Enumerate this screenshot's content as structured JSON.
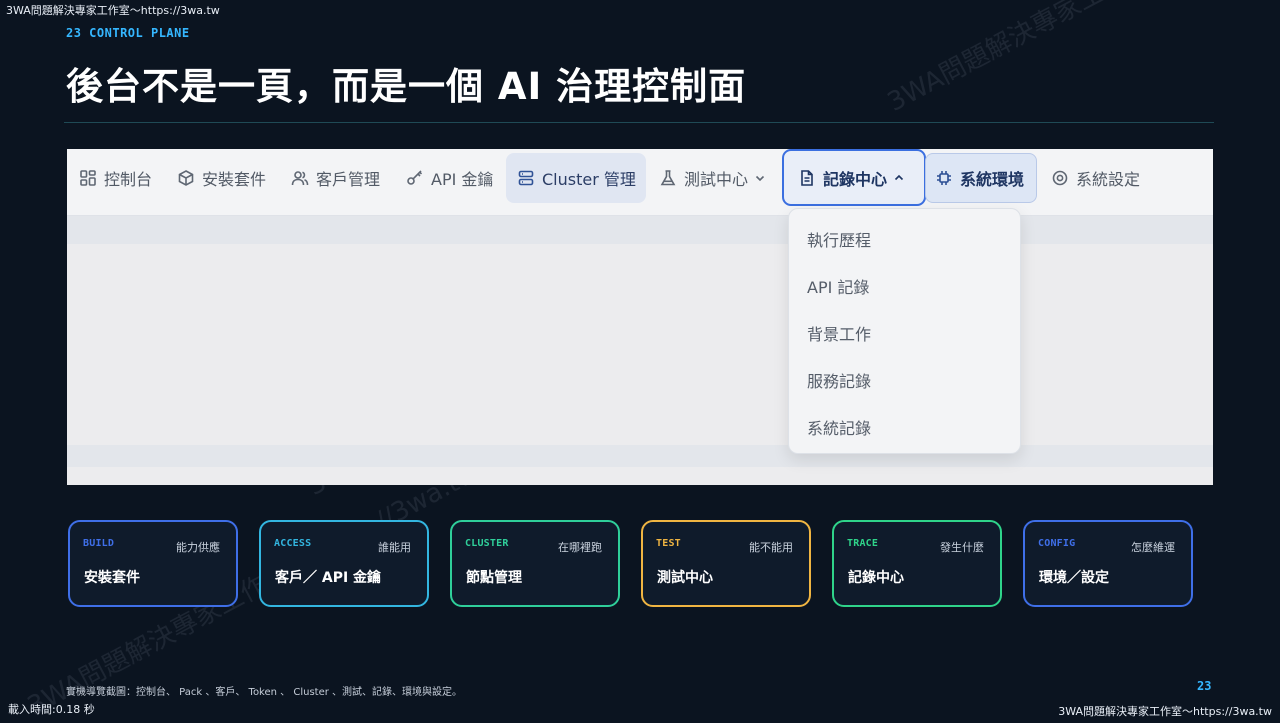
{
  "corner": {
    "top_left": "3WA問題解決專家工作室～https://3wa.tw",
    "bottom_left": "載入時間:0.18 秒",
    "bottom_right": "3WA問題解決專家工作室～https://3wa.tw"
  },
  "header": {
    "eyebrow": "23 CONTROL PLANE",
    "title": "後台不是一頁，而是一個 AI 治理控制面"
  },
  "screenshot": {
    "nav": [
      {
        "label": "控制台",
        "icon": "dashboard-icon"
      },
      {
        "label": "安裝套件",
        "icon": "cube-icon"
      },
      {
        "label": "客戶管理",
        "icon": "users-icon"
      },
      {
        "label": "API 金鑰",
        "icon": "key-icon"
      },
      {
        "label": "Cluster 管理",
        "icon": "server-icon"
      },
      {
        "label": "測試中心",
        "icon": "flask-icon"
      },
      {
        "label": "記錄中心",
        "icon": "document-icon"
      },
      {
        "label": "系統環境",
        "icon": "chip-icon"
      },
      {
        "label": "系統設定",
        "icon": "gear-icon"
      }
    ],
    "dropdown": [
      "執行歷程",
      "API 記錄",
      "背景工作",
      "服務記錄",
      "系統記錄"
    ]
  },
  "cards": [
    {
      "tag": "BUILD",
      "hint": "能力供應",
      "name": "安裝套件",
      "color": "#3f6fe8"
    },
    {
      "tag": "ACCESS",
      "hint": "誰能用",
      "name": "客戶／ API 金鑰",
      "color": "#33b6e0"
    },
    {
      "tag": "CLUSTER",
      "hint": "在哪裡跑",
      "name": "節點管理",
      "color": "#2fcf9a"
    },
    {
      "tag": "TEST",
      "hint": "能不能用",
      "name": "測試中心",
      "color": "#f0b542"
    },
    {
      "tag": "TRACE",
      "hint": "發生什麼",
      "name": "記錄中心",
      "color": "#2fd48a"
    },
    {
      "tag": "CONFIG",
      "hint": "怎麼維運",
      "name": "環境／設定",
      "color": "#3f6fe8"
    }
  ],
  "footer": {
    "note": "實機導覽截圖：控制台、 Pack 、客戶、 Token 、 Cluster 、測試、記錄、環境與設定。",
    "page": "23"
  },
  "watermark": "3WA問題解決專家工作室～https://3wa.tw"
}
